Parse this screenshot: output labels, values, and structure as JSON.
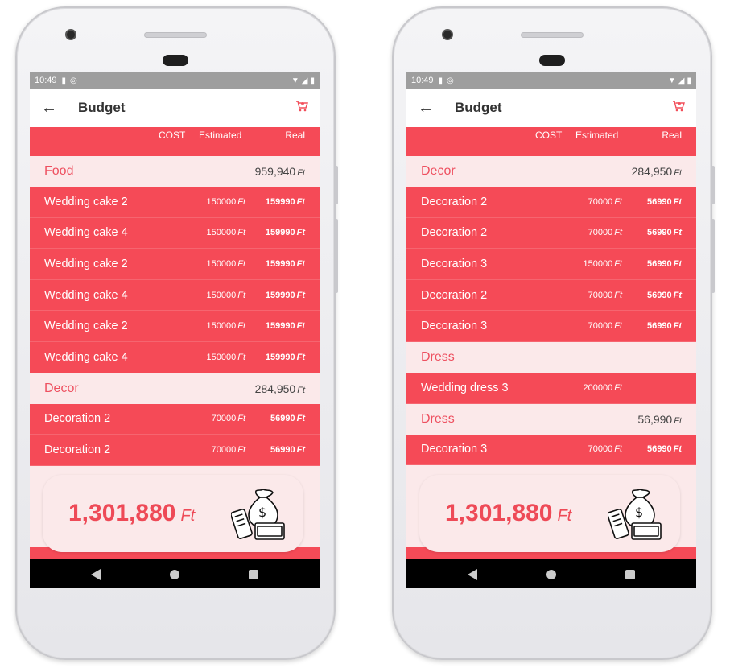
{
  "phones": [
    {
      "status": {
        "time": "10:49"
      },
      "appbar": {
        "title": "Budget"
      },
      "columns": {
        "cost": "COST",
        "estimated": "Estimated",
        "real": "Real"
      },
      "rows": [
        {
          "type": "section",
          "name": "Food",
          "total": "959,940",
          "unit": "Ft"
        },
        {
          "type": "item",
          "name": "Wedding cake 2",
          "est": "150000",
          "real": "159990",
          "unit": "Ft"
        },
        {
          "type": "item",
          "name": "Wedding cake 4",
          "est": "150000",
          "real": "159990",
          "unit": "Ft"
        },
        {
          "type": "item",
          "name": "Wedding cake 2",
          "est": "150000",
          "real": "159990",
          "unit": "Ft"
        },
        {
          "type": "item",
          "name": "Wedding cake 4",
          "est": "150000",
          "real": "159990",
          "unit": "Ft"
        },
        {
          "type": "item",
          "name": "Wedding cake 2",
          "est": "150000",
          "real": "159990",
          "unit": "Ft"
        },
        {
          "type": "item",
          "name": "Wedding cake 4",
          "est": "150000",
          "real": "159990",
          "unit": "Ft"
        },
        {
          "type": "section",
          "name": "Decor",
          "total": "284,950",
          "unit": "Ft"
        },
        {
          "type": "item",
          "name": "Decoration 2",
          "est": "70000",
          "real": "56990",
          "unit": "Ft"
        },
        {
          "type": "item",
          "name": "Decoration 2",
          "est": "70000",
          "real": "56990",
          "unit": "Ft"
        }
      ],
      "summary": {
        "amount": "1,301,880",
        "unit": "Ft"
      }
    },
    {
      "status": {
        "time": "10:49"
      },
      "appbar": {
        "title": "Budget"
      },
      "columns": {
        "cost": "COST",
        "estimated": "Estimated",
        "real": "Real"
      },
      "rows": [
        {
          "type": "section",
          "name": "Decor",
          "total": "284,950",
          "unit": "Ft"
        },
        {
          "type": "item",
          "name": "Decoration 2",
          "est": "70000",
          "real": "56990",
          "unit": "Ft"
        },
        {
          "type": "item",
          "name": "Decoration 2",
          "est": "70000",
          "real": "56990",
          "unit": "Ft"
        },
        {
          "type": "item",
          "name": "Decoration 3",
          "est": "150000",
          "real": "56990",
          "unit": "Ft"
        },
        {
          "type": "item",
          "name": "Decoration 2",
          "est": "70000",
          "real": "56990",
          "unit": "Ft"
        },
        {
          "type": "item",
          "name": "Decoration 3",
          "est": "70000",
          "real": "56990",
          "unit": "Ft"
        },
        {
          "type": "section",
          "name": "Dress",
          "total": "",
          "unit": ""
        },
        {
          "type": "item",
          "name": "Wedding dress 3",
          "est": "200000",
          "real": "",
          "unit": "Ft"
        },
        {
          "type": "section",
          "name": "Dress",
          "total": "56,990",
          "unit": "Ft"
        },
        {
          "type": "item",
          "name": "Decoration 3",
          "est": "70000",
          "real": "56990",
          "unit": "Ft"
        }
      ],
      "summary": {
        "amount": "1,301,880",
        "unit": "Ft"
      }
    }
  ],
  "colors": {
    "accent": "#f54a57",
    "section_bg": "#fbe9ea",
    "section_text": "#ee5060"
  },
  "icons": [
    "back-arrow-icon",
    "cart-add-icon",
    "money-bag-icon",
    "nav-back-icon",
    "nav-home-icon",
    "nav-recents-icon"
  ]
}
